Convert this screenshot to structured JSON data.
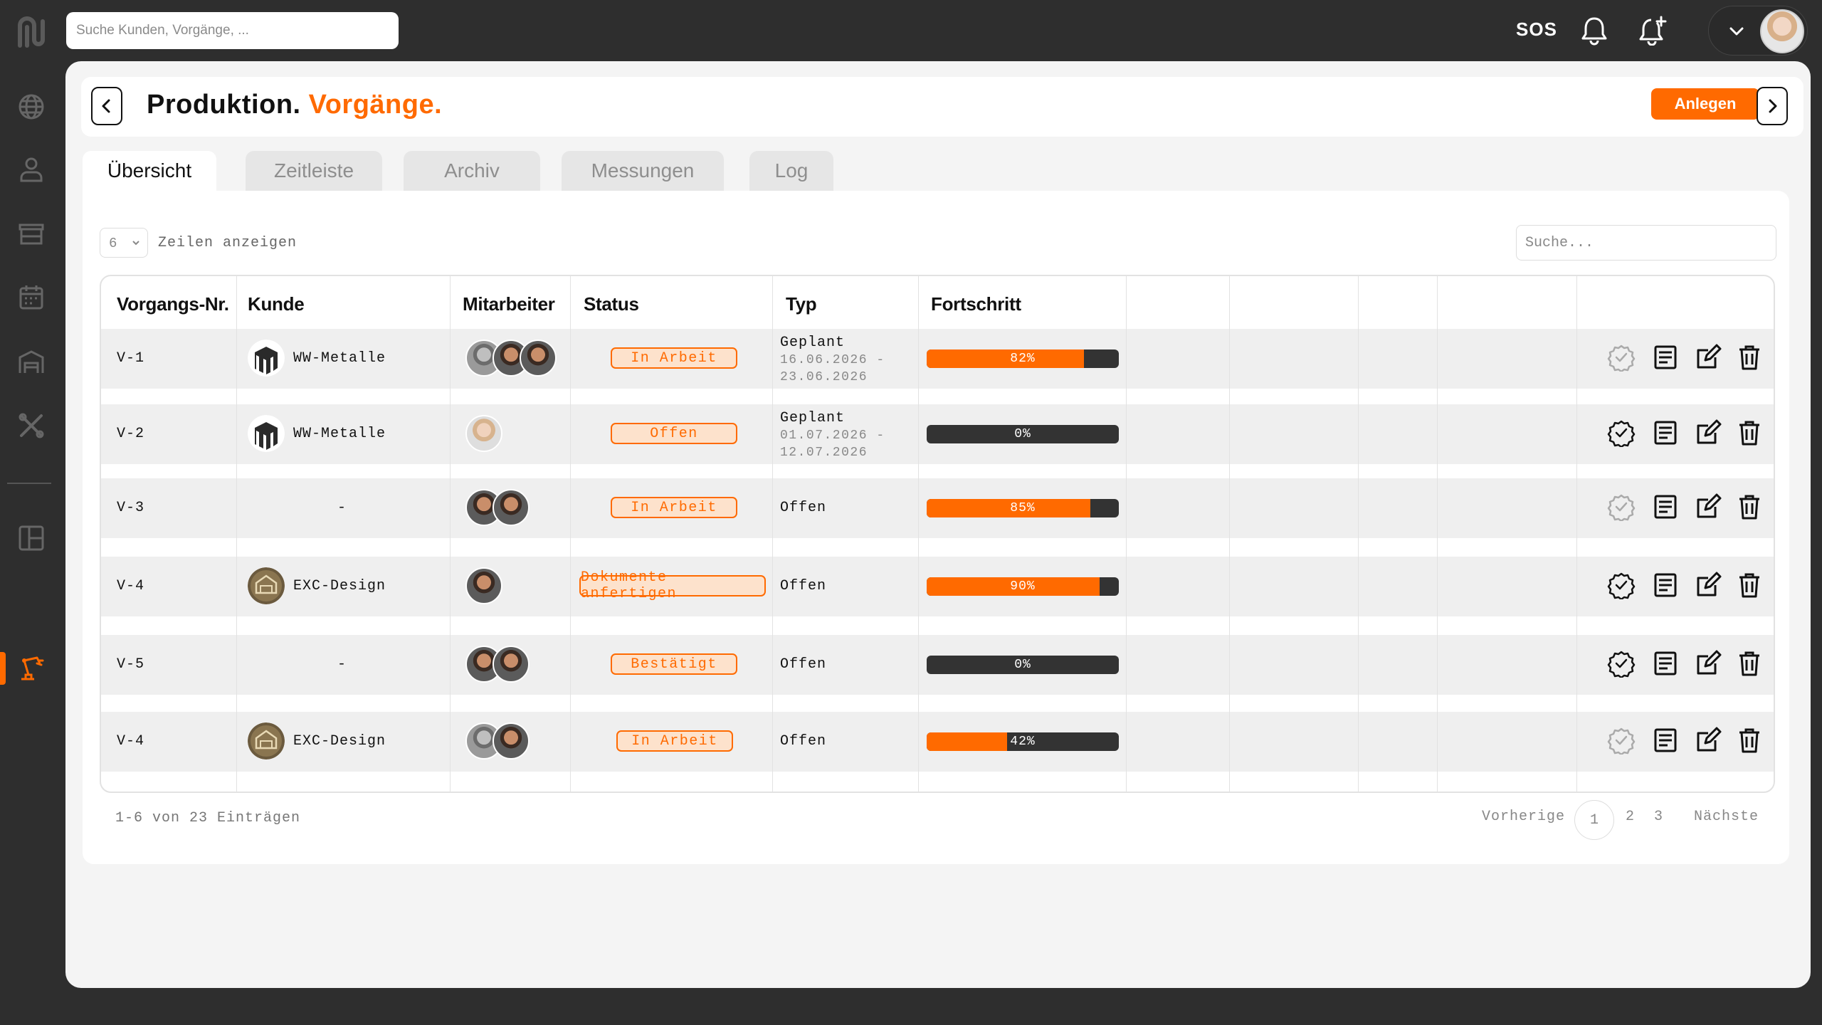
{
  "topbar": {
    "search_placeholder": "Suche Kunden, Vorgänge, ...",
    "sos_label": "SOS"
  },
  "header": {
    "title": "Produktion.",
    "title_accent": "Vorgänge.",
    "create_label": "Anlegen"
  },
  "tabs": [
    {
      "label": "Übersicht",
      "active": true
    },
    {
      "label": "Zeitleiste",
      "active": false
    },
    {
      "label": "Archiv",
      "active": false
    },
    {
      "label": "Messungen",
      "active": false
    },
    {
      "label": "Log",
      "active": false
    }
  ],
  "table_controls": {
    "rows_value": "6",
    "rows_label": "Zeilen anzeigen",
    "search_placeholder": "Suche..."
  },
  "columns": [
    "Vorgangs-Nr.",
    "Kunde",
    "Mitarbeiter",
    "Status",
    "Typ",
    "Fortschritt"
  ],
  "rows": [
    {
      "nr": "V-1",
      "kunde": "WW-Metalle",
      "status": "In Arbeit",
      "typ": "Geplant",
      "date_from": "16.06.2026 -",
      "date_to": "23.06.2026",
      "progress": 82,
      "progress_label": "82%"
    },
    {
      "nr": "V-2",
      "kunde": "WW-Metalle",
      "status": "Offen",
      "typ": "Geplant",
      "date_from": "01.07.2026 -",
      "date_to": "12.07.2026",
      "progress": 0,
      "progress_label": "0%"
    },
    {
      "nr": "V-3",
      "kunde": "-",
      "status": "In Arbeit",
      "typ": "Offen",
      "progress": 85,
      "progress_label": "85%"
    },
    {
      "nr": "V-4",
      "kunde": "EXC-Design",
      "status": "Dokumente anfertigen",
      "typ": "Offen",
      "progress": 90,
      "progress_label": "90%"
    },
    {
      "nr": "V-5",
      "kunde": "-",
      "status": "Bestätigt",
      "typ": "Offen",
      "progress": 0,
      "progress_label": "0%"
    },
    {
      "nr": "V-4",
      "kunde": "EXC-Design",
      "status": "In Arbeit",
      "typ": "Offen",
      "progress": 42,
      "progress_label": "42%"
    }
  ],
  "footer": {
    "info": "1-6 von 23 Einträgen",
    "prev": "Vorherige",
    "pages": [
      "1",
      "2",
      "3"
    ],
    "next": "Nächste"
  },
  "colors": {
    "accent": "#ff6a00",
    "dark_bg": "#2e2e2e",
    "status_fill": "#fde2cc"
  },
  "icons": {
    "sidebar": [
      "globe-icon",
      "user-icon",
      "store-icon",
      "calendar-icon",
      "warehouse-icon",
      "tools-icon",
      "layout-icon",
      "robot-arm-icon"
    ],
    "row_actions": [
      "verify-badge-icon",
      "document-icon",
      "edit-icon",
      "trash-icon"
    ]
  }
}
